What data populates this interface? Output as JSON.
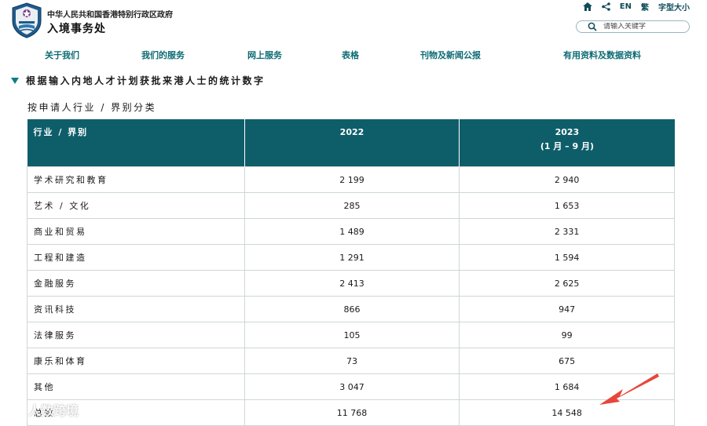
{
  "header": {
    "gov_name": "中华人民共和国香港特别行政区政府",
    "dept_name": "入境事务处",
    "links": {
      "lang_en": "EN",
      "lang_trad": "繁",
      "font_size": "字型大小"
    },
    "search": {
      "placeholder": "请输入关键字"
    }
  },
  "nav": {
    "items": [
      {
        "label": "关于我们"
      },
      {
        "label": "我们的服务"
      },
      {
        "label": "网上服务"
      },
      {
        "label": "表格"
      },
      {
        "label": "刊物及新闻公报"
      },
      {
        "label": "有用资料及数据资料"
      }
    ]
  },
  "page": {
    "title": "根据输入内地人才计划获批来港人士的统计数字",
    "subtitle": "按申请人行业 / 界别分类"
  },
  "table": {
    "headers": {
      "category": "行业 / 界别",
      "col1": "2022",
      "col2_line1": "2023",
      "col2_line2": "(1 月 – 9 月)"
    },
    "rows": [
      {
        "category": "学术研究和教育",
        "y2022": "2 199",
        "y2023": "2 940"
      },
      {
        "category": "艺术 / 文化",
        "y2022": "285",
        "y2023": "1 653"
      },
      {
        "category": "商业和贸易",
        "y2022": "1 489",
        "y2023": "2 331"
      },
      {
        "category": "工程和建造",
        "y2022": "1 291",
        "y2023": "1 594"
      },
      {
        "category": "金融服务",
        "y2022": "2 413",
        "y2023": "2 625"
      },
      {
        "category": "资讯科技",
        "y2022": "866",
        "y2023": "947"
      },
      {
        "category": "法律服务",
        "y2022": "105",
        "y2023": "99"
      },
      {
        "category": "康乐和体育",
        "y2022": "73",
        "y2023": "675"
      },
      {
        "category": "其他",
        "y2022": "3 047",
        "y2023": "1 684"
      },
      {
        "category": "总数",
        "y2022": "11 768",
        "y2023": "14 548"
      }
    ]
  },
  "watermark": {
    "text": "人数跨境"
  },
  "icons": [
    "logo-emblem-icon",
    "home-icon",
    "share-icon",
    "search-icon",
    "expand-triangle-icon",
    "annotation-arrow-icon"
  ],
  "colors": {
    "header_bg": "#0e5e6a",
    "nav_text": "#0b6a73",
    "accent": "#127a8a",
    "arrow": "#e8463c"
  }
}
